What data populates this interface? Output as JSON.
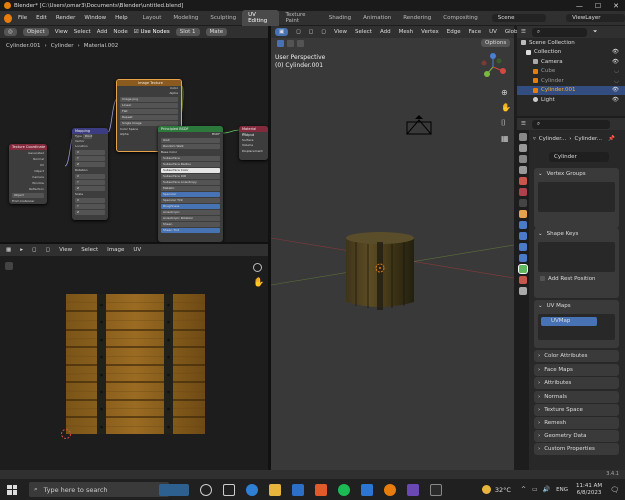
{
  "title_bar": {
    "title": "Blender* [C:\\Users\\omar3\\Documents\\Blender\\untitled.blend]",
    "minimize": "—",
    "maximize": "☐",
    "close": "✕"
  },
  "menu": {
    "items": [
      "File",
      "Edit",
      "Render",
      "Window",
      "Help"
    ],
    "workspaces": [
      "Layout",
      "Modeling",
      "Sculpting",
      "UV Editing",
      "Texture Paint",
      "Shading",
      "Animation",
      "Rendering",
      "Compositing"
    ],
    "active_workspace": "UV Editing",
    "scene": "Scene",
    "view_layer": "ViewLayer"
  },
  "node_editor": {
    "header": {
      "mode": "Object",
      "menus": [
        "View",
        "Select",
        "Add",
        "Node"
      ],
      "use_nodes": "Use Nodes",
      "slot": "Slot 1",
      "material": "Mate"
    },
    "breadcrumb": [
      "Cylinder.001",
      "Cylinder",
      "Material.002"
    ],
    "nodes": {
      "texcoord": {
        "title": "Texture Coordinate",
        "outputs": [
          "Generated",
          "Normal",
          "UV",
          "Object",
          "Camera",
          "Window",
          "Reflection"
        ],
        "object_label": "Object",
        "from_instancer": "From Instancer"
      },
      "mapping": {
        "title": "Mapping",
        "rows": [
          "Type",
          "Vector",
          "Location",
          "X",
          "Y",
          "Z",
          "Rotation",
          "X",
          "Y",
          "Z",
          "Scale",
          "X",
          "Y",
          "Z"
        ],
        "type_value": "Point"
      },
      "image": {
        "title": "Image Texture",
        "outputs": [
          "Color",
          "Alpha"
        ],
        "rows": [
          "Image.png",
          "Linear",
          "Flat",
          "Repeat",
          "Single Image",
          "Color Space",
          "Alpha"
        ],
        "cs_value": "sRGB",
        "alpha_value": "Straight"
      },
      "bsdf": {
        "title": "Principled BSDF",
        "rows": [
          "GGX",
          "Random Walk",
          "Base Color",
          "Subsurface",
          "Subsurface Radius",
          "Subsurface Color",
          "Subsurface IOR",
          "Subsurface Anisotropy",
          "Metallic",
          "Specular",
          "Specular Tint",
          "Roughness",
          "Anisotropic",
          "Anisotropic Rotation",
          "Sheen",
          "Sheen Tint"
        ],
        "out": "BSDF"
      },
      "output": {
        "title": "Material Output",
        "rows": [
          "All",
          "Surface",
          "Volume",
          "Displacement"
        ]
      }
    }
  },
  "uv_editor": {
    "header": {
      "menus": [
        "View",
        "Select",
        "Image",
        "UV"
      ]
    }
  },
  "viewport": {
    "header": {
      "menus": [
        "View",
        "Select",
        "Add",
        "Mesh",
        "Vertex",
        "Edge",
        "Face",
        "UV"
      ],
      "orientation": "Global"
    },
    "options": "Options",
    "overlay_line1": "User Perspective",
    "overlay_line2": "(0) Cylinder.001",
    "gizmo": {
      "x": "X",
      "y": "Y",
      "z": "Z"
    }
  },
  "outliner": {
    "rows": [
      {
        "label": "Scene Collection",
        "selected": false,
        "indent": 0
      },
      {
        "label": "Collection",
        "selected": false,
        "indent": 1
      },
      {
        "label": "Camera",
        "selected": false,
        "indent": 2
      },
      {
        "label": "Cube",
        "selected": false,
        "indent": 2
      },
      {
        "label": "Cylinder",
        "selected": false,
        "indent": 2
      },
      {
        "label": "Cylinder.001",
        "selected": true,
        "indent": 2
      },
      {
        "label": "Light",
        "selected": false,
        "indent": 2
      }
    ]
  },
  "properties": {
    "breadcrumb": [
      "Cylinder...",
      "Cylinder..."
    ],
    "mesh_name": "Cylinder",
    "vertex_groups": "Vertex Groups",
    "shape_keys": "Shape Keys",
    "add_rest_position": "Add Rest Position",
    "uv_maps": "UV Maps",
    "uv_map_name": "UVMap",
    "panels": [
      "Color Attributes",
      "Face Maps",
      "Attributes",
      "Normals",
      "Texture Space",
      "Remesh",
      "Geometry Data",
      "Custom Properties"
    ]
  },
  "version": "3.4.1",
  "taskbar": {
    "search_placeholder": "Type here to search",
    "weather": "32°C",
    "lang": "ENG",
    "time": "11:41 AM",
    "date": "6/8/2023"
  }
}
